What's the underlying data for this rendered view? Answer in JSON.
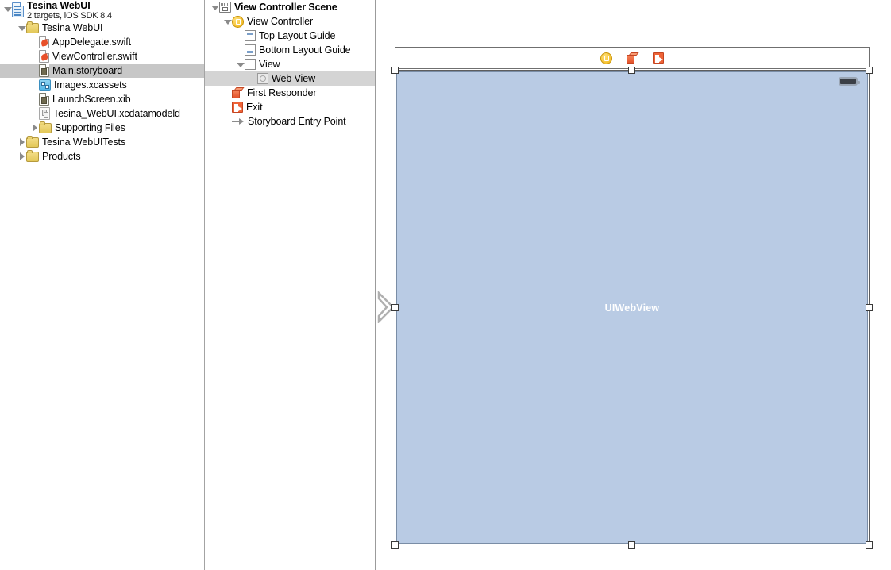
{
  "navigator": {
    "project": {
      "name": "Tesina WebUI",
      "subtitle": "2 targets, iOS SDK 8.4",
      "icon": "project-icon"
    },
    "items": [
      {
        "label": "Tesina WebUI",
        "icon": "folder-icon",
        "disclosure": "open",
        "indent": 1,
        "selected": false
      },
      {
        "label": "AppDelegate.swift",
        "icon": "swift-file-icon",
        "disclosure": "none",
        "indent": 2,
        "selected": false
      },
      {
        "label": "ViewController.swift",
        "icon": "swift-file-icon",
        "disclosure": "none",
        "indent": 2,
        "selected": false
      },
      {
        "label": "Main.storyboard",
        "icon": "storyboard-file-icon",
        "disclosure": "none",
        "indent": 2,
        "selected": true
      },
      {
        "label": "Images.xcassets",
        "icon": "xcassets-icon",
        "disclosure": "none",
        "indent": 2,
        "selected": false
      },
      {
        "label": "LaunchScreen.xib",
        "icon": "xib-file-icon",
        "disclosure": "none",
        "indent": 2,
        "selected": false
      },
      {
        "label": "Tesina_WebUI.xcdatamodeld",
        "icon": "datamodel-icon",
        "disclosure": "none",
        "indent": 2,
        "selected": false
      },
      {
        "label": "Supporting Files",
        "icon": "folder-icon",
        "disclosure": "closed",
        "indent": 2,
        "selected": false
      },
      {
        "label": "Tesina WebUITests",
        "icon": "folder-icon",
        "disclosure": "closed",
        "indent": 1,
        "selected": false
      },
      {
        "label": "Products",
        "icon": "folder-icon",
        "disclosure": "closed",
        "indent": 1,
        "selected": false
      }
    ]
  },
  "outline": {
    "items": [
      {
        "label": "View Controller Scene",
        "icon": "scene-icon",
        "disclosure": "open",
        "indent": 0,
        "bold": true,
        "selected": false
      },
      {
        "label": "View Controller",
        "icon": "view-controller-icon",
        "disclosure": "open",
        "indent": 1,
        "bold": false,
        "selected": false
      },
      {
        "label": "Top Layout Guide",
        "icon": "top-layout-guide-icon",
        "disclosure": "none",
        "indent": 2,
        "bold": false,
        "selected": false
      },
      {
        "label": "Bottom Layout Guide",
        "icon": "bottom-layout-guide-icon",
        "disclosure": "none",
        "indent": 2,
        "bold": false,
        "selected": false
      },
      {
        "label": "View",
        "icon": "view-icon",
        "disclosure": "open",
        "indent": 2,
        "bold": false,
        "selected": false
      },
      {
        "label": "Web View",
        "icon": "web-view-icon",
        "disclosure": "none",
        "indent": 3,
        "bold": false,
        "selected": true
      },
      {
        "label": "First Responder",
        "icon": "first-responder-icon",
        "disclosure": "none",
        "indent": 1,
        "bold": false,
        "selected": false
      },
      {
        "label": "Exit",
        "icon": "exit-icon",
        "disclosure": "none",
        "indent": 1,
        "bold": false,
        "selected": false
      },
      {
        "label": "Storyboard Entry Point",
        "icon": "storyboard-entry-point-icon",
        "disclosure": "none",
        "indent": 1,
        "bold": false,
        "selected": false
      }
    ]
  },
  "canvas": {
    "scene_dock": {
      "icons": [
        {
          "name": "view-controller-dock-icon",
          "title": "View Controller"
        },
        {
          "name": "first-responder-dock-icon",
          "title": "First Responder"
        },
        {
          "name": "exit-dock-icon",
          "title": "Exit"
        }
      ]
    },
    "selected_view": {
      "label": "UIWebView",
      "fill_color": "#b9cbe4",
      "border_color": "#7a8da6"
    },
    "status_bar": {
      "battery_icon": "battery-icon"
    },
    "entry_point_arrow": "storyboard-entry-point-arrow"
  },
  "colors": {
    "selection_gray": "#c7c7c7",
    "outline_selection_gray": "#d4d4d4",
    "webview_blue": "#b9cbe4",
    "divider": "#a3a3a3"
  }
}
